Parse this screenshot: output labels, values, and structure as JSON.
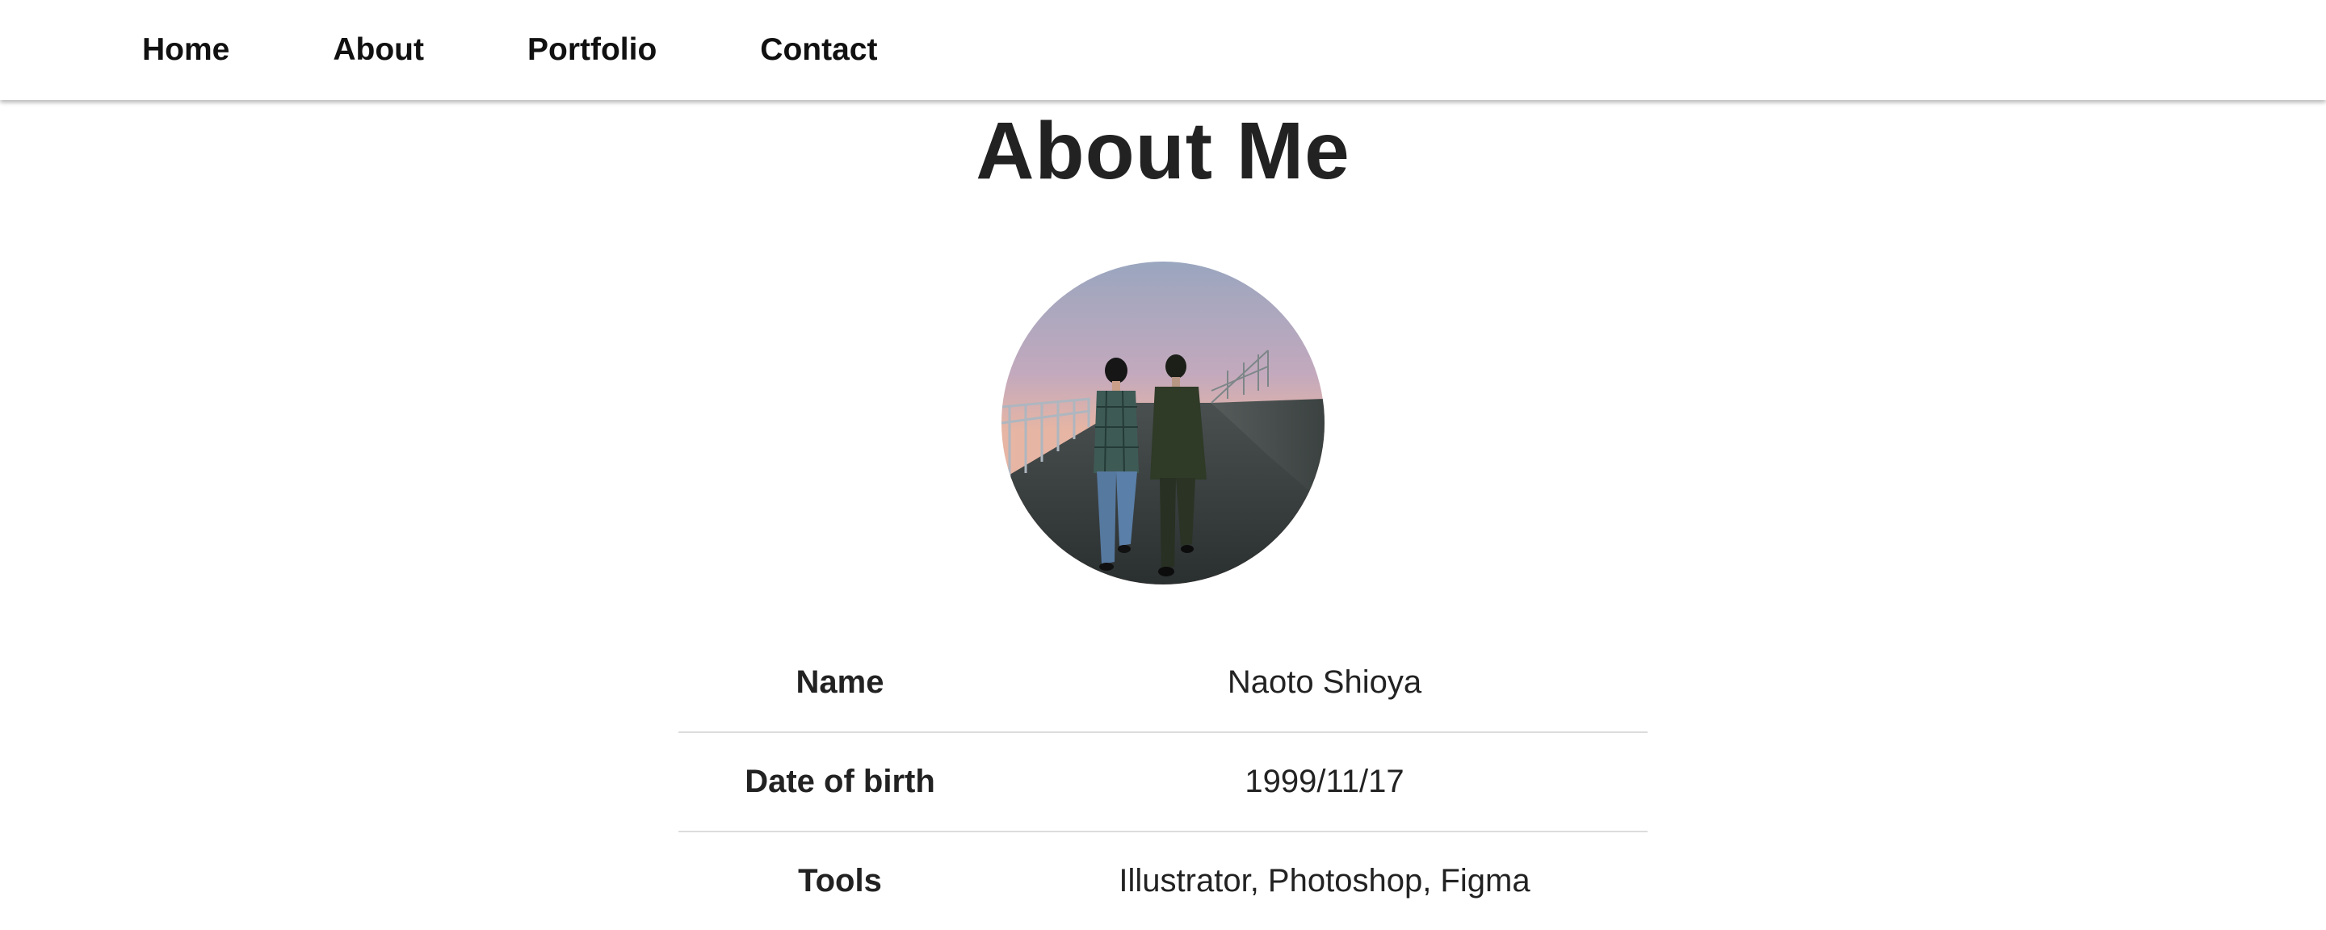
{
  "nav": {
    "items": [
      {
        "label": "Home"
      },
      {
        "label": "About"
      },
      {
        "label": "Portfolio"
      },
      {
        "label": "Contact"
      }
    ]
  },
  "main": {
    "title": "About Me",
    "profile": {
      "rows": [
        {
          "label": "Name",
          "value": "Naoto Shioya"
        },
        {
          "label": "Date of birth",
          "value": "1999/11/17"
        },
        {
          "label": "Tools",
          "value": "Illustrator, Photoshop, Figma"
        }
      ]
    }
  },
  "colors": {
    "text": "#222222",
    "nav_text": "#111111",
    "divider": "#dcdcdc",
    "background": "#ffffff"
  }
}
